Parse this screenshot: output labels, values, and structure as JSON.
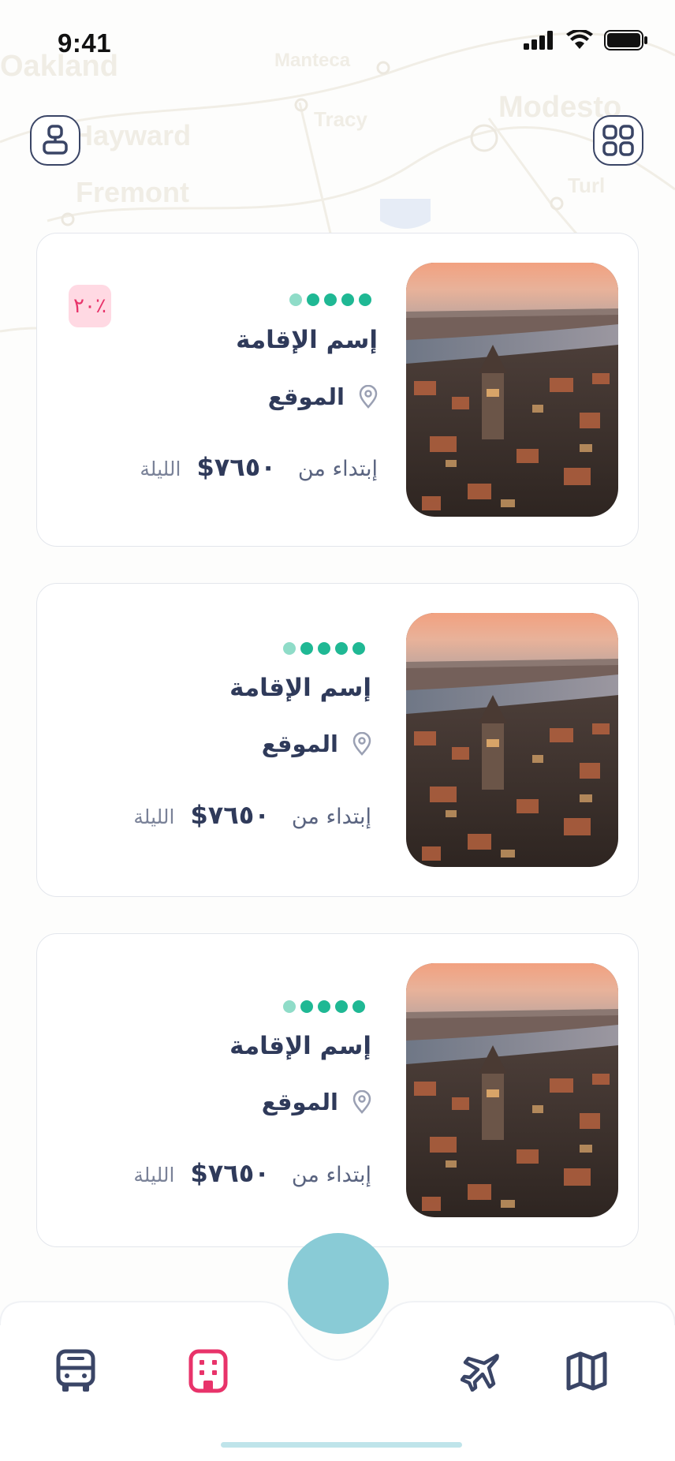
{
  "status_bar": {
    "time": "9:41"
  },
  "map_labels": [
    "Oakland",
    "Hayward",
    "Fremont",
    "Manteca",
    "Tracy",
    "Modesto",
    "Turl"
  ],
  "header": {
    "left_icon": "profile-icon",
    "right_icon": "grid-icon"
  },
  "cards": [
    {
      "name": "إسم الإقامة",
      "location": "الموقع",
      "price_from": "إبتداء من",
      "price": "$٧٦٥٠",
      "per_night": "الليلة",
      "rating": 5,
      "discount": "٢٠٪"
    },
    {
      "name": "إسم الإقامة",
      "location": "الموقع",
      "price_from": "إبتداء من",
      "price": "$٧٦٥٠",
      "per_night": "الليلة",
      "rating": 5
    },
    {
      "name": "إسم الإقامة",
      "location": "الموقع",
      "price_from": "إبتداء من",
      "price": "$٧٦٥٠",
      "per_night": "الليلة",
      "rating": 5
    }
  ],
  "bottom_nav": {
    "items": [
      {
        "icon": "bus-icon",
        "active": false
      },
      {
        "icon": "hotel-icon",
        "active": true
      },
      {
        "icon": "plane-icon",
        "active": false
      },
      {
        "icon": "map-icon",
        "active": false
      }
    ]
  },
  "colors": {
    "primary_text": "#2f3a5a",
    "rating_green": "#1fb894",
    "accent_pink": "#e8336a",
    "fab_teal": "#89cbd6"
  }
}
